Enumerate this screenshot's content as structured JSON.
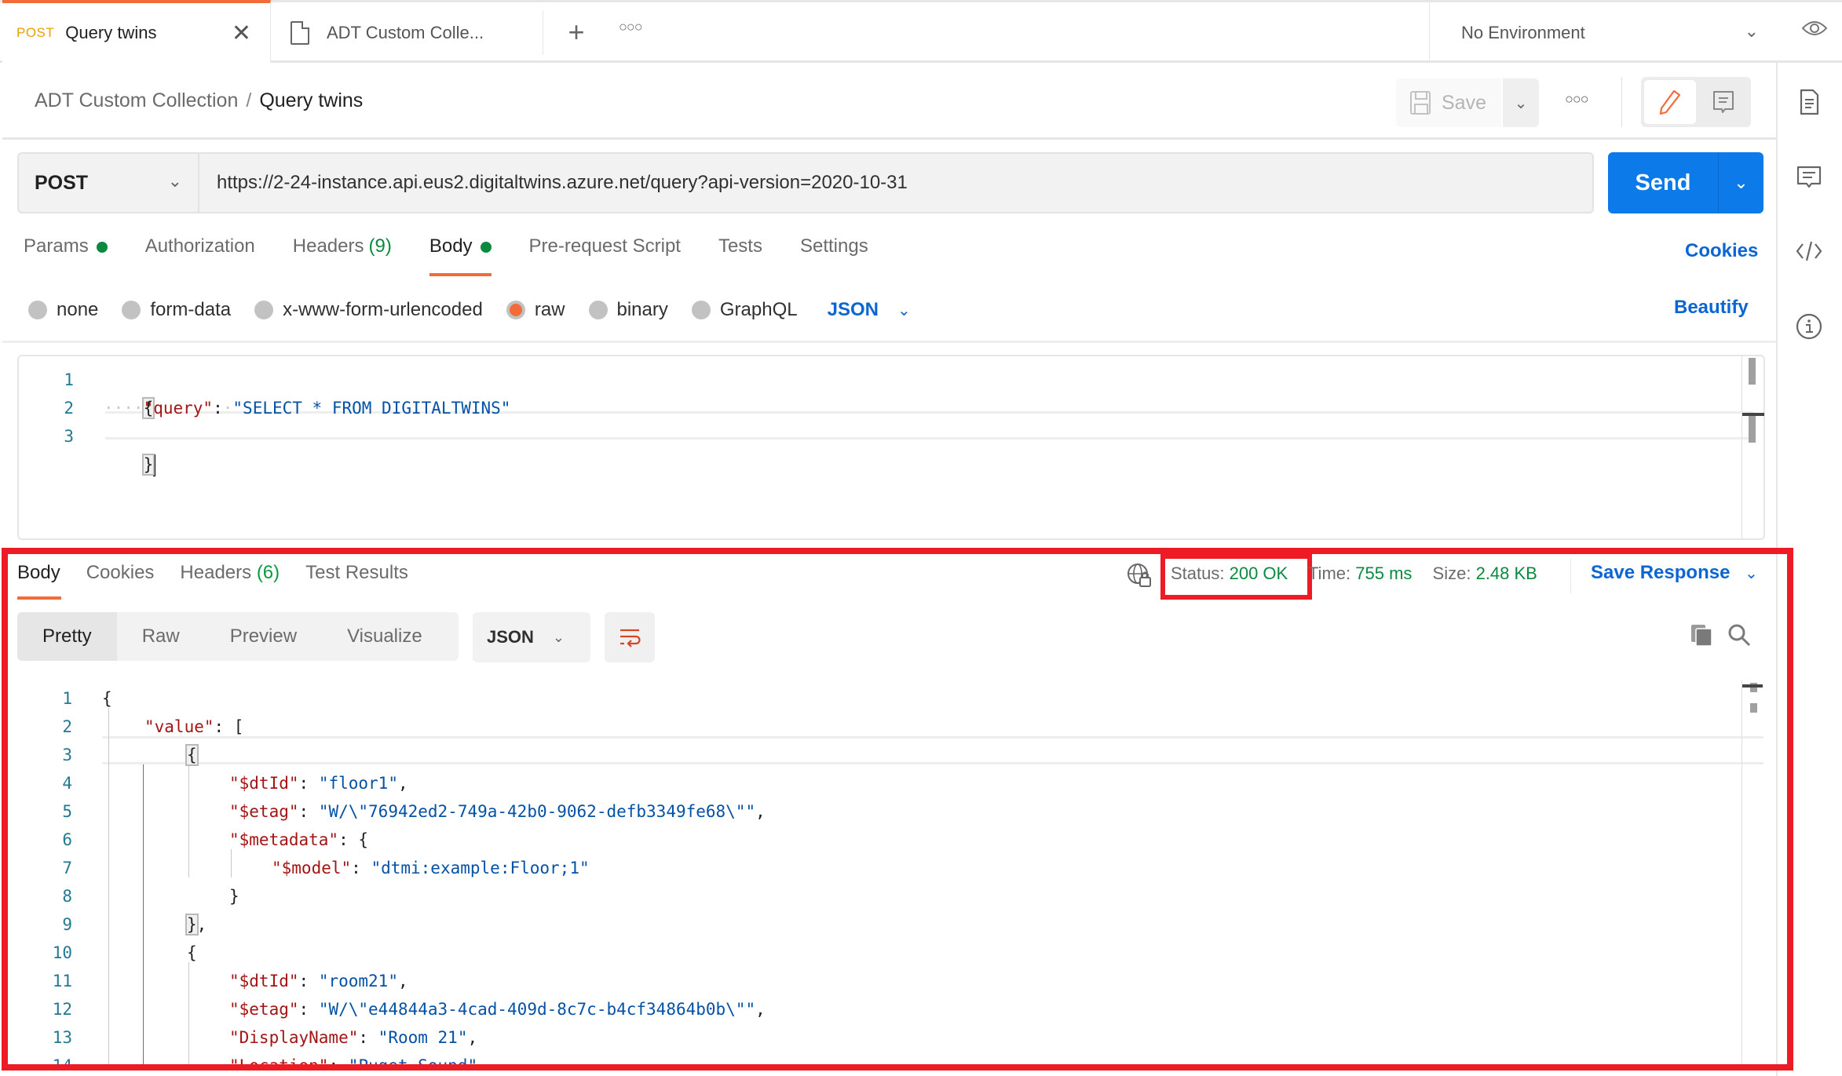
{
  "tabs": [
    {
      "method": "POST",
      "name": "Query twins",
      "active": true
    },
    {
      "name": "ADT Custom Colle...",
      "active": false
    }
  ],
  "environment": {
    "selected": "No Environment"
  },
  "breadcrumb": {
    "parent": "ADT Custom Collection",
    "separator": "/",
    "current": "Query twins"
  },
  "toolbar": {
    "save_label": "Save"
  },
  "request": {
    "method": "POST",
    "url": "https://2-24-instance.api.eus2.digitaltwins.azure.net/query?api-version=2020-10-31",
    "send_label": "Send",
    "tabs": [
      {
        "label": "Params",
        "dot": true
      },
      {
        "label": "Authorization"
      },
      {
        "label": "Headers",
        "count": "(9)"
      },
      {
        "label": "Body",
        "dot": true,
        "active": true
      },
      {
        "label": "Pre-request Script"
      },
      {
        "label": "Tests"
      },
      {
        "label": "Settings"
      }
    ],
    "cookies_label": "Cookies",
    "body_types": [
      "none",
      "form-data",
      "x-www-form-urlencoded",
      "raw",
      "binary",
      "GraphQL"
    ],
    "body_type_selected": "raw",
    "language": "JSON",
    "beautify_label": "Beautify",
    "body_lines": [
      "1",
      "2",
      "3"
    ],
    "body": {
      "open": "{",
      "key": "\"query\"",
      "colon": ":",
      "value": "\"SELECT * FROM DIGITALTWINS\"",
      "close": "}"
    }
  },
  "response": {
    "tabs": [
      {
        "label": "Body",
        "active": true
      },
      {
        "label": "Cookies"
      },
      {
        "label": "Headers",
        "count": "(6)"
      },
      {
        "label": "Test Results"
      }
    ],
    "status_label": "Status:",
    "status_value": "200 OK",
    "time_label": "Time:",
    "time_value": "755 ms",
    "size_label": "Size:",
    "size_value": "2.48 KB",
    "save_response_label": "Save Response",
    "view_modes": [
      "Pretty",
      "Raw",
      "Preview",
      "Visualize"
    ],
    "view_mode_selected": "Pretty",
    "language": "JSON",
    "lines": [
      {
        "n": "1",
        "tokens": [
          {
            "t": "p",
            "v": "{"
          }
        ]
      },
      {
        "n": "2",
        "tokens": [
          {
            "t": "k",
            "v": "\"value\""
          },
          {
            "t": "p",
            "v": ": ["
          }
        ]
      },
      {
        "n": "3",
        "tokens": [
          {
            "t": "p",
            "v": "{"
          }
        ]
      },
      {
        "n": "4",
        "tokens": [
          {
            "t": "k",
            "v": "\"$dtId\""
          },
          {
            "t": "p",
            "v": ": "
          },
          {
            "t": "s",
            "v": "\"floor1\""
          },
          {
            "t": "p",
            "v": ","
          }
        ]
      },
      {
        "n": "5",
        "tokens": [
          {
            "t": "k",
            "v": "\"$etag\""
          },
          {
            "t": "p",
            "v": ": "
          },
          {
            "t": "s",
            "v": "\"W/\\\"76942ed2-749a-42b0-9062-defb3349fe68\\\"\""
          },
          {
            "t": "p",
            "v": ","
          }
        ]
      },
      {
        "n": "6",
        "tokens": [
          {
            "t": "k",
            "v": "\"$metadata\""
          },
          {
            "t": "p",
            "v": ": {"
          }
        ]
      },
      {
        "n": "7",
        "tokens": [
          {
            "t": "k",
            "v": "\"$model\""
          },
          {
            "t": "p",
            "v": ": "
          },
          {
            "t": "s",
            "v": "\"dtmi:example:Floor;1\""
          }
        ]
      },
      {
        "n": "8",
        "tokens": [
          {
            "t": "p",
            "v": "}"
          }
        ]
      },
      {
        "n": "9",
        "tokens": [
          {
            "t": "p",
            "v": "},"
          }
        ]
      },
      {
        "n": "10",
        "tokens": [
          {
            "t": "p",
            "v": "{"
          }
        ]
      },
      {
        "n": "11",
        "tokens": [
          {
            "t": "k",
            "v": "\"$dtId\""
          },
          {
            "t": "p",
            "v": ": "
          },
          {
            "t": "s",
            "v": "\"room21\""
          },
          {
            "t": "p",
            "v": ","
          }
        ]
      },
      {
        "n": "12",
        "tokens": [
          {
            "t": "k",
            "v": "\"$etag\""
          },
          {
            "t": "p",
            "v": ": "
          },
          {
            "t": "s",
            "v": "\"W/\\\"e44844a3-4cad-409d-8c7c-b4cf34864b0b\\\"\""
          },
          {
            "t": "p",
            "v": ","
          }
        ]
      },
      {
        "n": "13",
        "tokens": [
          {
            "t": "k",
            "v": "\"DisplayName\""
          },
          {
            "t": "p",
            "v": ": "
          },
          {
            "t": "s",
            "v": "\"Room 21\""
          },
          {
            "t": "p",
            "v": ","
          }
        ]
      },
      {
        "n": "14",
        "tokens": [
          {
            "t": "k",
            "v": "\"Location\""
          },
          {
            "t": "p",
            "v": ": "
          },
          {
            "t": "s",
            "v": "\"Puget Sound\""
          },
          {
            "t": "p",
            "v": ","
          }
        ]
      }
    ]
  },
  "colors": {
    "accent": "#f26b3a",
    "primary": "#0c7ae8",
    "link": "#0b66d4",
    "success": "#0b8a3f",
    "highlight_box": "#ed1c24",
    "json_key": "#a31515",
    "json_string": "#0451a5"
  },
  "icons": {
    "close": "close-icon",
    "document": "document-icon",
    "plus": "plus-icon",
    "more": "more-horizontal-icon",
    "eye": "eye-icon",
    "save": "floppy-disk-icon",
    "edit": "pencil-icon",
    "comment": "comment-icon",
    "code": "code-icon",
    "info": "info-icon",
    "globe": "globe-lock-icon",
    "wrap": "word-wrap-icon",
    "copy": "copy-icon",
    "search": "search-icon"
  }
}
